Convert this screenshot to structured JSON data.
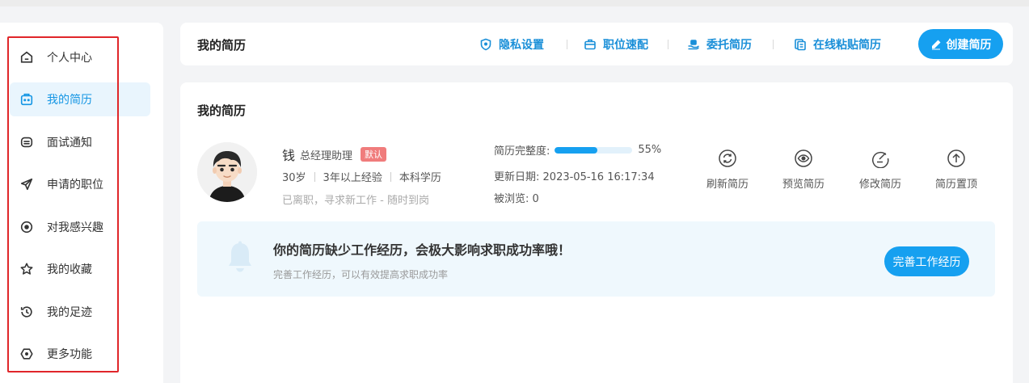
{
  "sidebar": {
    "items": [
      {
        "label": "个人中心",
        "icon": "home-icon",
        "active": false
      },
      {
        "label": "我的简历",
        "icon": "resume-icon",
        "active": true
      },
      {
        "label": "面试通知",
        "icon": "interview-icon",
        "active": false
      },
      {
        "label": "申请的职位",
        "icon": "send-icon",
        "active": false
      },
      {
        "label": "对我感兴趣",
        "icon": "eye-icon",
        "active": false
      },
      {
        "label": "我的收藏",
        "icon": "star-icon",
        "active": false
      },
      {
        "label": "我的足迹",
        "icon": "history-icon",
        "active": false
      },
      {
        "label": "更多功能",
        "icon": "more-icon",
        "active": false
      }
    ]
  },
  "header": {
    "title": "我的简历",
    "links": [
      {
        "label": "隐私设置",
        "icon": "shield-icon"
      },
      {
        "label": "职位速配",
        "icon": "briefcase-icon"
      },
      {
        "label": "委托简历",
        "icon": "hand-icon"
      },
      {
        "label": "在线粘贴简历",
        "icon": "paste-icon"
      }
    ],
    "create_label": "创建简历"
  },
  "resume": {
    "section_title": "我的简历",
    "name": "钱",
    "job": "总经理助理",
    "badge": "默认",
    "age": "30岁",
    "experience": "3年以上经验",
    "education": "本科学历",
    "status": "已离职，寻求新工作 - 随时到岗",
    "completeness_label": "简历完整度:",
    "completeness_value": "55%",
    "completeness_fraction": 0.55,
    "updated_label": "更新日期:",
    "updated_value": "2023-05-16 16:17:34",
    "views_label": "被浏览:",
    "views_value": "0",
    "actions": [
      {
        "label": "刷新简历",
        "icon": "refresh-icon"
      },
      {
        "label": "预览简历",
        "icon": "preview-icon"
      },
      {
        "label": "修改简历",
        "icon": "edit-icon"
      },
      {
        "label": "简历置顶",
        "icon": "top-icon"
      }
    ]
  },
  "notice": {
    "title": "你的简历缺少工作经历，会极大影响求职成功率哦！",
    "subtitle": "完善工作经历，可以有效提高求职成功率",
    "button": "完善工作经历"
  },
  "colors": {
    "accent": "#16a0f0",
    "highlight_border": "#e0262a",
    "badge": "#f07c7c"
  }
}
